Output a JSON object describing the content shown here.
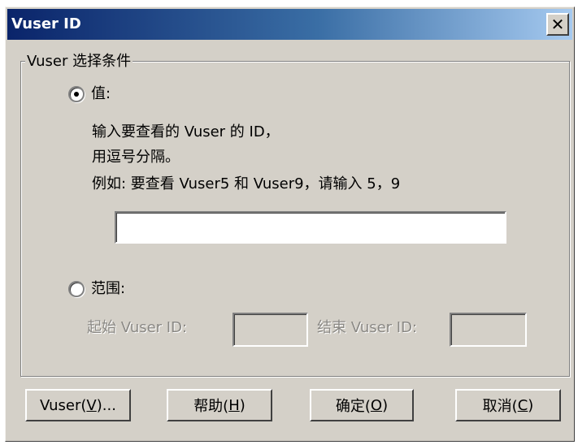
{
  "window": {
    "title": "Vuser ID",
    "close_glyph": "✕"
  },
  "group": {
    "legend": "Vuser 选择条件"
  },
  "value_option": {
    "label": "值:",
    "selected": true,
    "help_line1": "输入要查看的 Vuser 的 ID，",
    "help_line2": "用逗号分隔。",
    "help_line3": "例如: 要查看 Vuser5 和 Vuser9，请输入 5，9",
    "input_value": ""
  },
  "range_option": {
    "label": "范围:",
    "selected": false,
    "start_label": "起始 Vuser ID:",
    "end_label": "结束 Vuser ID:",
    "start_value": "",
    "end_value": ""
  },
  "buttons": {
    "vuser": {
      "prefix": "Vuser(",
      "mnemonic": "V",
      "suffix": ")..."
    },
    "help": {
      "prefix": "帮助(",
      "mnemonic": "H",
      "suffix": ")"
    },
    "ok": {
      "prefix": "确定(",
      "mnemonic": "O",
      "suffix": ")"
    },
    "cancel": {
      "prefix": "取消(",
      "mnemonic": "C",
      "suffix": ")"
    }
  },
  "colors": {
    "dialog_bg": "#d4d0c8",
    "title_gradient_start": "#0a246a",
    "title_gradient_end": "#a6caf0",
    "disabled_text": "#8a8884"
  }
}
